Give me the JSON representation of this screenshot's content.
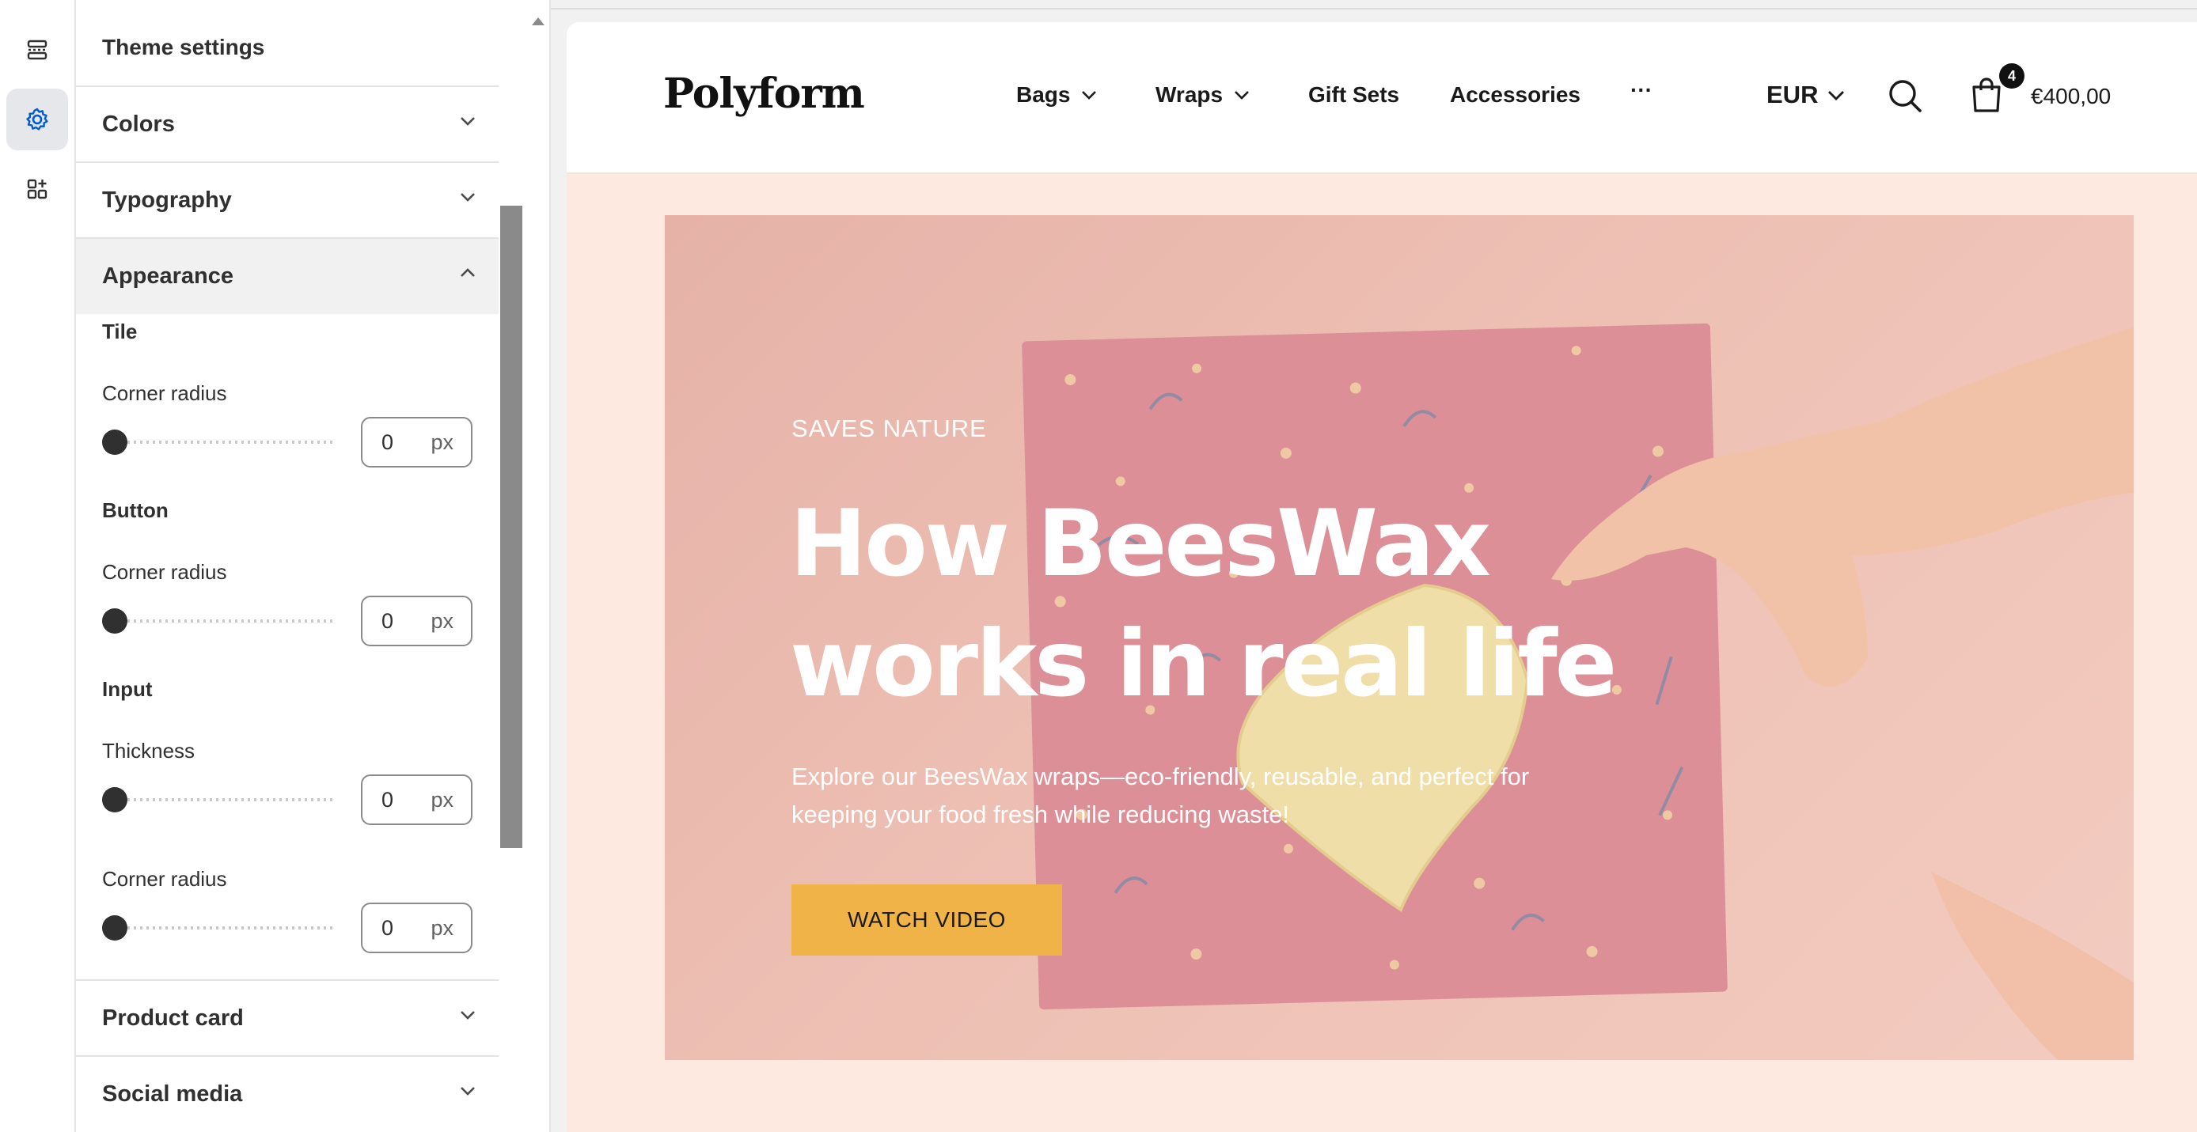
{
  "sidebar_panel": {
    "title": "Theme settings",
    "sections": {
      "colors": "Colors",
      "typography": "Typography",
      "appearance": "Appearance",
      "product_card": "Product card",
      "social_media": "Social media"
    },
    "appearance": {
      "tile": {
        "heading": "Tile",
        "corner_radius_label": "Corner radius",
        "corner_radius_value": "0",
        "unit": "px"
      },
      "button": {
        "heading": "Button",
        "corner_radius_label": "Corner radius",
        "corner_radius_value": "0",
        "unit": "px"
      },
      "input": {
        "heading": "Input",
        "thickness_label": "Thickness",
        "thickness_value": "0",
        "corner_radius_label": "Corner radius",
        "corner_radius_value": "0",
        "unit": "px"
      }
    }
  },
  "store": {
    "logo": "Polyform",
    "nav": {
      "bags": "Bags",
      "wraps": "Wraps",
      "gift_sets": "Gift Sets",
      "accessories": "Accessories",
      "more": "···"
    },
    "currency": "EUR",
    "cart_count": "4",
    "cart_total": "€400,00"
  },
  "hero": {
    "eyebrow": "SAVES NATURE",
    "title": "How BeesWax works in real life",
    "description": "Explore our BeesWax wraps—eco-friendly, reusable, and perfect for keeping your food fresh while reducing waste!",
    "button": "WATCH VIDEO"
  },
  "colors": {
    "accent": "#f0b347",
    "rail_active": "#005bd3",
    "preview_bg": "#fde9e0"
  },
  "icons": {
    "rail": [
      "sections-icon",
      "settings-gear-icon",
      "apps-add-icon"
    ]
  }
}
